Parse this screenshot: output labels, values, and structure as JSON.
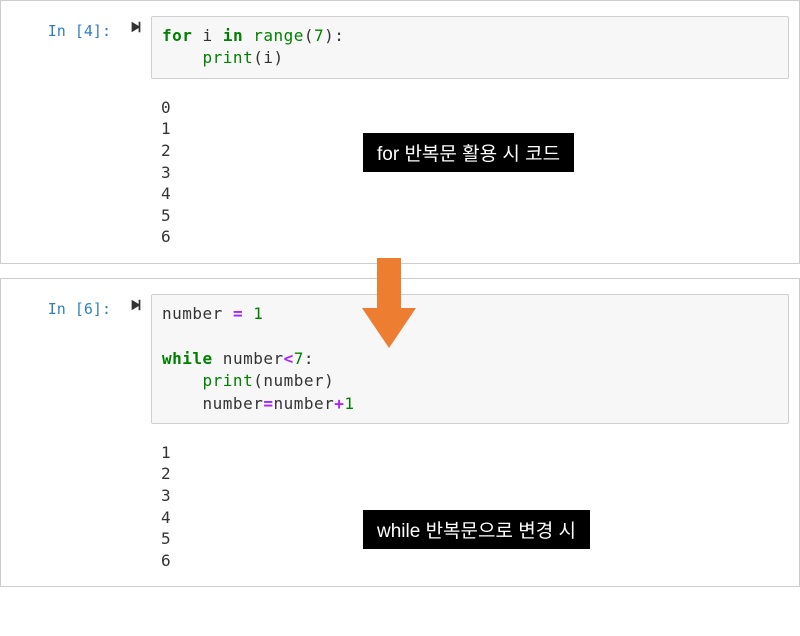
{
  "cell1": {
    "prompt": "In [4]:",
    "code": {
      "line1_kw1": "for",
      "line1_var1": " i ",
      "line1_kw2": "in",
      "line1_builtin": " range",
      "line1_paren": "(",
      "line1_num": "7",
      "line1_end": "):",
      "line2_indent": "    ",
      "line2_builtin": "print",
      "line2_rest": "(i)"
    },
    "output": "0\n1\n2\n3\n4\n5\n6"
  },
  "cell2": {
    "prompt": "In [6]:",
    "code": {
      "line1_var": "number ",
      "line1_op": "=",
      "line1_rest": " ",
      "line1_num": "1",
      "blank": "",
      "line3_kw": "while",
      "line3_rest": " number",
      "line3_op": "<",
      "line3_num": "7",
      "line3_colon": ":",
      "line4_indent": "    ",
      "line4_builtin": "print",
      "line4_rest": "(number)",
      "line5_indent": "    ",
      "line5_var": "number",
      "line5_op1": "=",
      "line5_var2": "number",
      "line5_op2": "+",
      "line5_num": "1"
    },
    "output": "1\n2\n3\n4\n5\n6"
  },
  "annotations": {
    "label1": "for 반복문 활용 시 코드",
    "label2": "while 반복문으로 변경 시"
  },
  "colors": {
    "arrow": "#ed7d31"
  }
}
